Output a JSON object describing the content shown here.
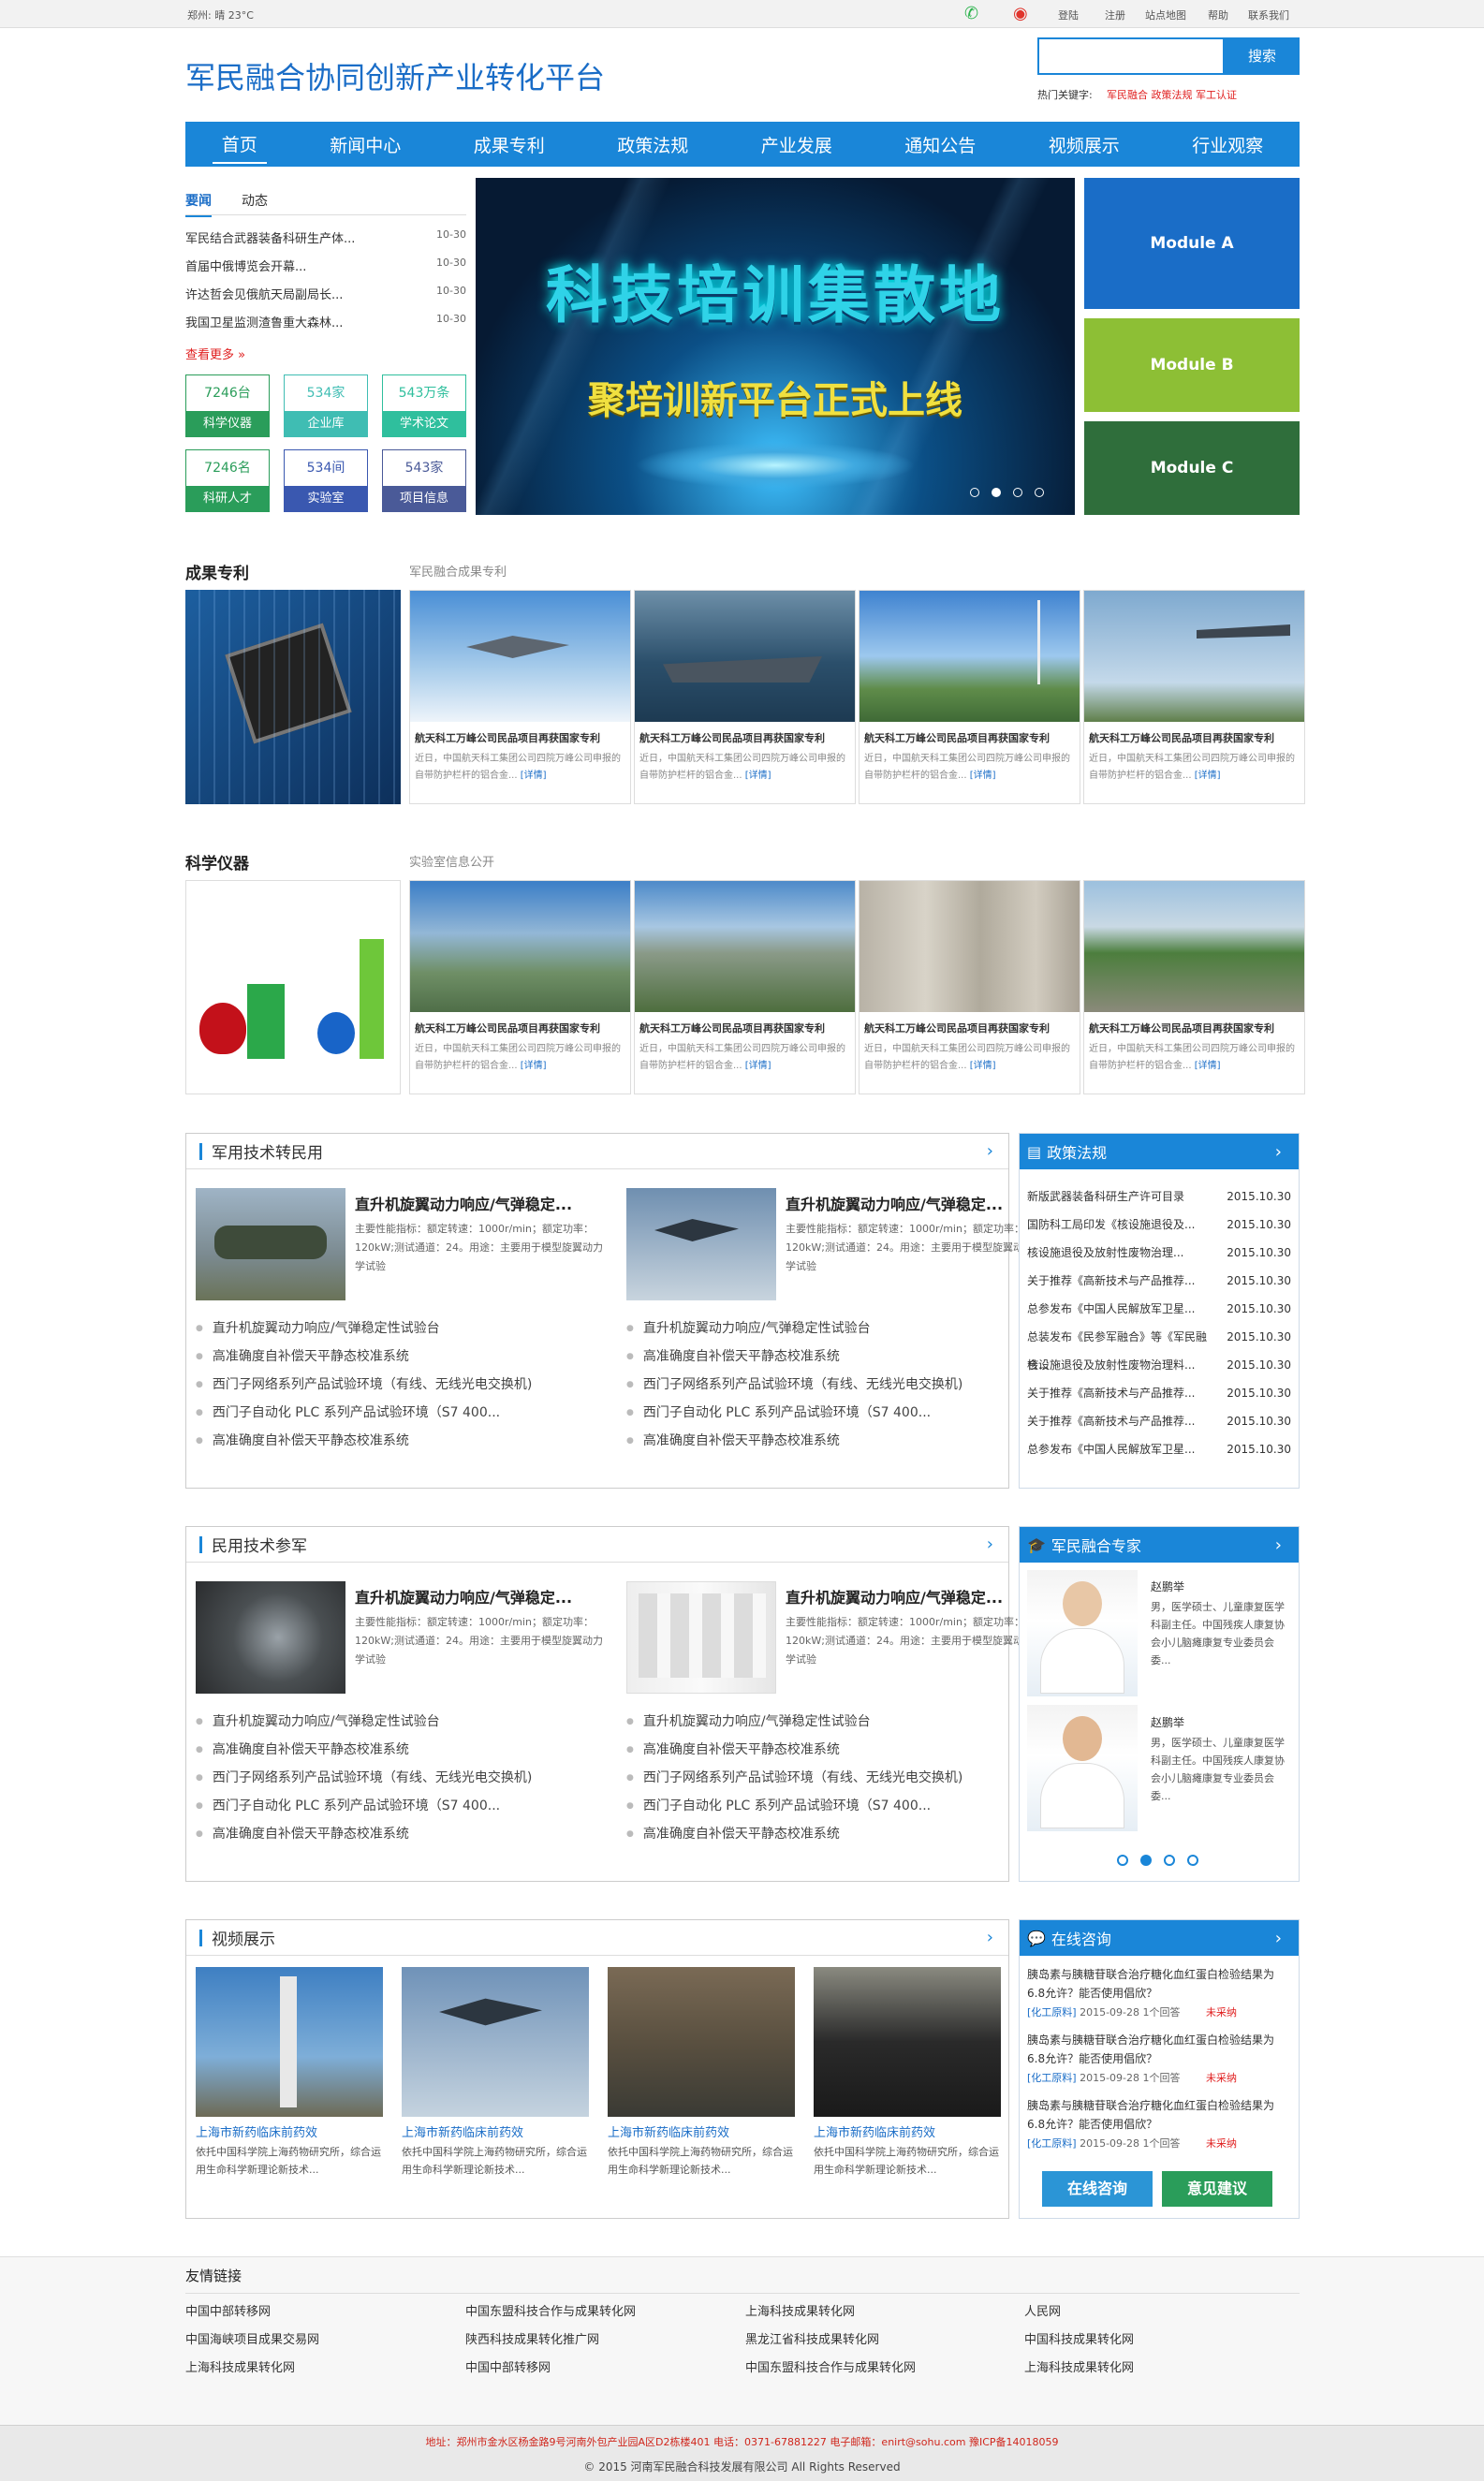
{
  "topbar": {
    "weather": "郑州: 晴 23°C",
    "links": [
      "登陆",
      "注册",
      "站点地图",
      "帮助",
      "联系我们"
    ]
  },
  "site_title": "军民融合协同创新产业转化平台",
  "search": {
    "button": "搜索",
    "placeholder": "",
    "hot_label": "热门关键字:",
    "hot_words": "军民融合 政策法规 军工认证"
  },
  "nav": [
    "首页",
    "新闻中心",
    "成果专利",
    "政策法规",
    "产业发展",
    "通知公告",
    "视频展示",
    "行业观察"
  ],
  "news": {
    "tabs": [
      "要闻",
      "动态"
    ],
    "items": [
      {
        "t": "军民结合武器装备科研生产体...",
        "d": "10-30"
      },
      {
        "t": "首届中俄博览会开幕...",
        "d": "10-30"
      },
      {
        "t": "许达哲会见俄航天局副局长...",
        "d": "10-30"
      },
      {
        "t": "我国卫星监测渣鲁重大森林...",
        "d": "10-30"
      }
    ],
    "more": "查看更多 »"
  },
  "stats": [
    {
      "v": "7246台",
      "l": "科学仪器"
    },
    {
      "v": "534家",
      "l": "企业库"
    },
    {
      "v": "543万条",
      "l": "学术论文"
    },
    {
      "v": "7246名",
      "l": "科研人才"
    },
    {
      "v": "534间",
      "l": "实验室"
    },
    {
      "v": "543家",
      "l": "项目信息"
    }
  ],
  "banner": {
    "line1": "科技培训集散地",
    "line2": "聚培训新平台正式上线"
  },
  "modules": [
    "Module A",
    "Module B",
    "Module C"
  ],
  "sec1": {
    "title": "成果专利",
    "sub": "军民融合成果专利"
  },
  "sec2": {
    "title": "科学仪器",
    "sub": "实验室信息公开"
  },
  "card_title": "航天科工万峰公司民品项目再获国家专利",
  "card_desc": "近日，中国航天科工集团公司四院万峰公司申报的自带防护栏杆的铝合金...",
  "card_more": "[详情]",
  "box1": {
    "title": "军用技术转民用"
  },
  "box2": {
    "title": "民用技术参军"
  },
  "feat_title": "直升机旋翼动力响应/气弹稳定...",
  "feat_desc": "主要性能指标：额定转速：1000r/min；额定功率：120kW;测试通道：24。用途：主要用于模型旋翼动力学试验",
  "list_items": [
    "直升机旋翼动力响应/气弹稳定性试验台",
    "高准确度自补偿天平静态校准系统",
    "西门子网络系列产品试验环境（有线、无线光电交换机)",
    "西门子自动化 PLC 系列产品试验环境（S7 400...",
    "高准确度自补偿天平静态校准系统"
  ],
  "policy": {
    "title": "政策法规",
    "items": [
      {
        "t": "新版武器装备科研生产许可目录",
        "d": "2015.10.30"
      },
      {
        "t": "国防科工局印发《核设施退役及...",
        "d": "2015.10.30"
      },
      {
        "t": "核设施退役及放射性废物治理...",
        "d": "2015.10.30"
      },
      {
        "t": "关于推荐《高新技术与产品推荐...",
        "d": "2015.10.30"
      },
      {
        "t": "总参发布《中国人民解放军卫星...",
        "d": "2015.10.30"
      },
      {
        "t": "总装发布《民参军融合》等《军民融合...",
        "d": "2015.10.30"
      },
      {
        "t": "核设施退役及放射性废物治理料...",
        "d": "2015.10.30"
      },
      {
        "t": "关于推荐《高新技术与产品推荐...",
        "d": "2015.10.30"
      },
      {
        "t": "关于推荐《高新技术与产品推荐...",
        "d": "2015.10.30"
      },
      {
        "t": "总参发布《中国人民解放军卫星...",
        "d": "2015.10.30"
      }
    ]
  },
  "experts": {
    "title": "军民融合专家",
    "items": [
      {
        "name": "赵鹏举",
        "desc": "男，医学硕士、儿童康复医学科副主任。中国残疾人康复协会小儿脑瘫康复专业委员会委..."
      },
      {
        "name": "赵鹏举",
        "desc": "男，医学硕士、儿童康复医学科副主任。中国残疾人康复协会小儿脑瘫康复专业委员会委..."
      }
    ]
  },
  "video": {
    "title": "视频展示",
    "item_title": "上海市新药临床前药效",
    "item_desc": "依托中国科学院上海药物研究所，综合运用生命科学新理论新技术..."
  },
  "consult": {
    "title": "在线咨询",
    "q": "胰岛素与胰糖苷联合治疗糖化血红蛋白检验结果为6.8允许？能否使用倡欣？",
    "tag": "[化工原料]",
    "meta": "2015-09-28 1个回答",
    "status": "未采纳",
    "btn1": "在线咨询",
    "btn2": "意见建议"
  },
  "links": {
    "title": "友情链接",
    "items": [
      "中国中部转移网",
      "中国东盟科技合作与成果转化网",
      "上海科技成果转化网",
      "人民网",
      "中国海峡项目成果交易网",
      "陕西科技成果转化推广网",
      "黑龙江省科技成果转化网",
      "中国科技成果转化网",
      "上海科技成果转化网",
      "中国中部转移网",
      "中国东盟科技合作与成果转化网",
      "上海科技成果转化网"
    ]
  },
  "footer": {
    "address": "地址：郑州市金水区杨金路9号河南外包产业园A区D2栋楼401 电话：0371-67881227 电子邮箱：enirt@sohu.com 豫ICP备14018059",
    "copy": "© 2015 河南军民融合科技发展有限公司 All Rights Reserved"
  },
  "colors": {
    "blue": "#1a86d8",
    "green": "#2a9d5a",
    "lime": "#8dbf35",
    "dark_green": "#2f6e3b",
    "red": "#e02020"
  }
}
